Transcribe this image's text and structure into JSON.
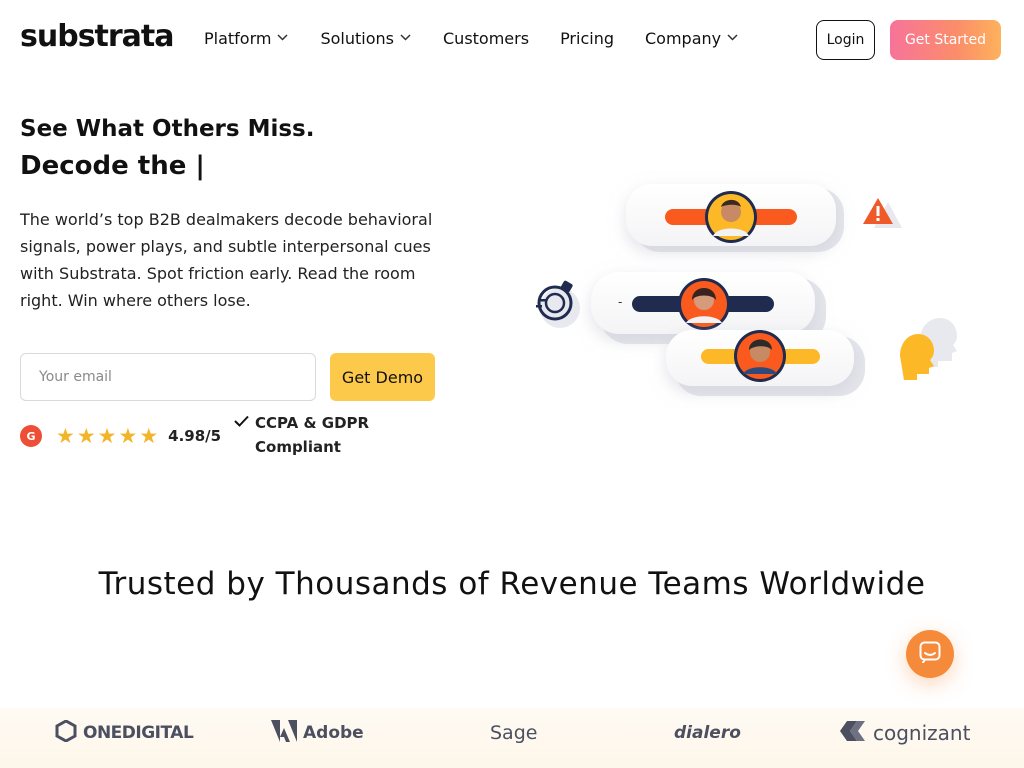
{
  "brand": {
    "name": "substrata"
  },
  "nav": {
    "items": [
      {
        "label": "Platform",
        "has_dropdown": true
      },
      {
        "label": "Solutions",
        "has_dropdown": true
      },
      {
        "label": "Customers",
        "has_dropdown": false
      },
      {
        "label": "Pricing",
        "has_dropdown": false
      },
      {
        "label": "Company",
        "has_dropdown": true
      }
    ],
    "login_label": "Login",
    "get_started_label": "Get Started"
  },
  "hero": {
    "headline_1": "See What Others Miss.",
    "headline_2": "Decode the |",
    "description": "The world’s top B2B dealmakers decode behavioral signals, power plays, and subtle interpersonal cues with Substrata. Spot friction early. Read the room right. Win where others lose.",
    "email_placeholder": "Your email",
    "demo_label": "Get Demo",
    "rating_badge": "G",
    "rating_value": "4.98/5",
    "stars": 5,
    "compliance": "CCPA & GDPR Compliant",
    "illustration_dash": "-"
  },
  "colors": {
    "accent_gradient_start": "#f7739a",
    "accent_gradient_end": "#fdb25c",
    "demo_button": "#fdc94a",
    "chat_button": "#f58a3a",
    "bar_orange": "#fb5a1e",
    "bar_navy": "#1f2b4f",
    "bar_yellow": "#fdb827"
  },
  "trusted": {
    "heading": "Trusted by Thousands of Revenue Teams Worldwide",
    "logos": [
      "ONEDIGITAL",
      "Adobe",
      "Sage",
      "dialero",
      "cognizant"
    ]
  },
  "icons": {
    "chat": "chat-bubble-icon",
    "warning": "warning-icon",
    "stopwatch": "stopwatch-icon",
    "head": "head-icon",
    "check": "check-icon",
    "star": "star-icon"
  }
}
